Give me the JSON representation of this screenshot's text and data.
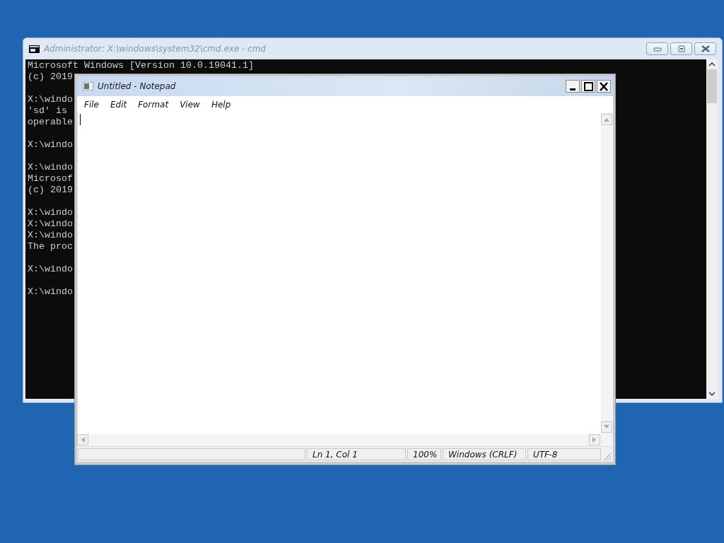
{
  "console_window": {
    "title": "Administrator: X:\\windows\\system32\\cmd.exe - cmd",
    "active": false,
    "blocks": [
      [
        "Microsoft Windows [Version 10.0.19041.1]",
        "(c) 2019"
      ],
      [
        "X:\\windo",
        "'sd' is",
        "operable"
      ],
      [
        "X:\\windo"
      ],
      [
        "X:\\windo",
        "Microsof",
        "(c) 2019"
      ],
      [
        "X:\\windo",
        "X:\\windo",
        "X:\\windo",
        "The proc"
      ],
      [
        "X:\\windo"
      ],
      [
        "X:\\windo"
      ]
    ]
  },
  "notepad_window": {
    "title": "Untitled - Notepad",
    "active": true,
    "menu": [
      "File",
      "Edit",
      "Format",
      "View",
      "Help"
    ],
    "status_bar": [
      "Ln 1, Col 1",
      "100%",
      "Windows (CRLF)",
      "UTF-8"
    ]
  }
}
